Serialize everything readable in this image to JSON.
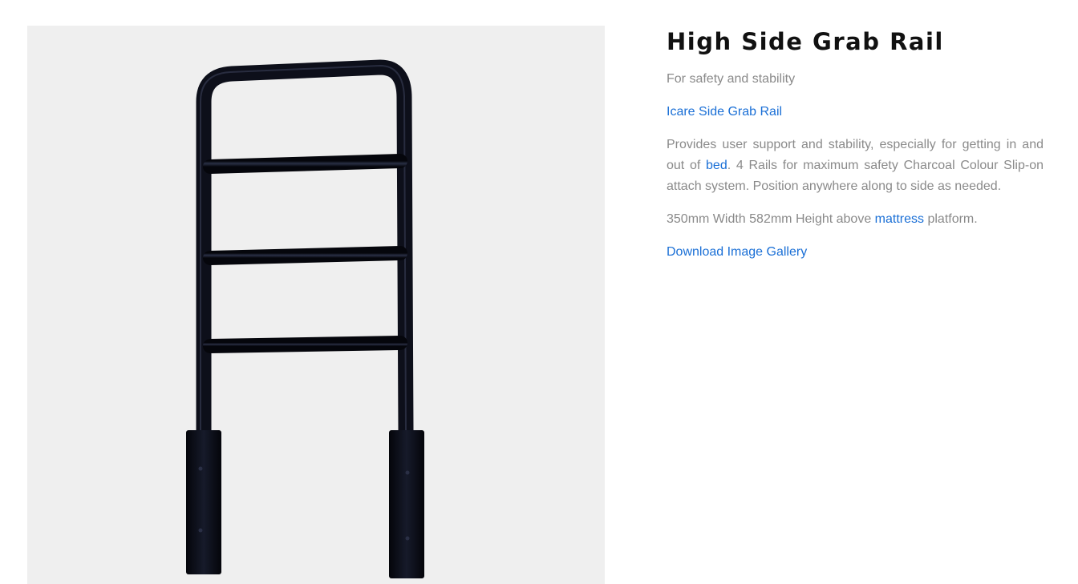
{
  "product": {
    "title": "High Side Grab Rail",
    "subtitle": "For safety and stability",
    "brand_link": "Icare Side Grab Rail",
    "description": {
      "part1": "Provides user support and stability, especially for getting in and out of ",
      "link_bed": "bed",
      "part2": ". 4 Rails for maximum safety Charcoal Colour Slip-on attach system. Position anywhere along to side as needed."
    },
    "dimensions": {
      "part1": "350mm Width 582mm Height above ",
      "link_mattress": "mattress",
      "part2": " platform."
    },
    "gallery_link": "Download Image Gallery",
    "image_alt": "High Side Grab Rail product photo"
  },
  "colors": {
    "link": "#1a6fd6",
    "text": "#8a8a8a",
    "title": "#111111",
    "image_bg": "#efefef",
    "rail": "#0d0f1a"
  }
}
